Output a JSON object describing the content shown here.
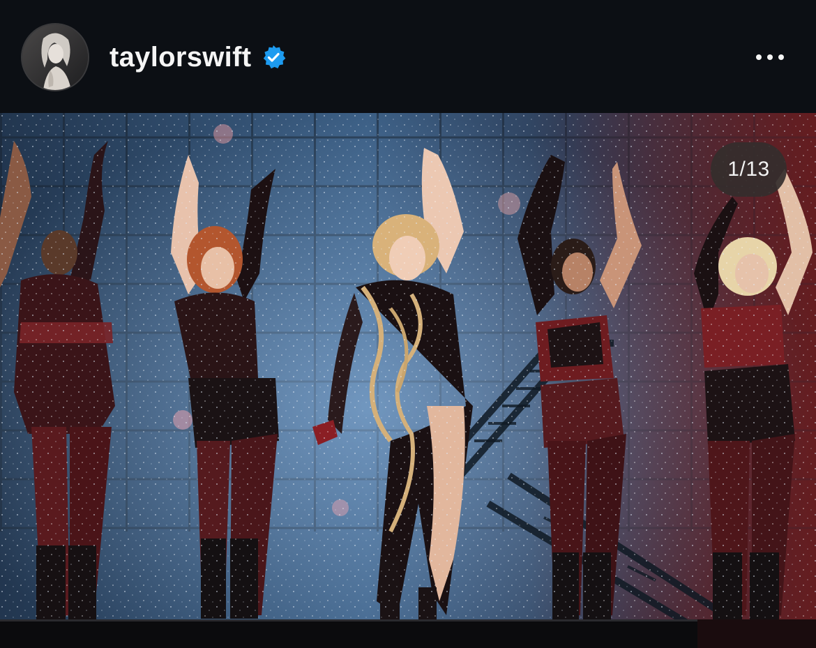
{
  "post": {
    "username": "taylorswift",
    "verified": true,
    "avatar_icon": "profile-photo-avatar",
    "more_icon": "more-options-icon",
    "carousel_counter": "1/13"
  },
  "colors": {
    "background": "#0c0f14",
    "username_text": "#f5f5f5",
    "verified_blue": "#1d9bf0",
    "counter_bg": "#342e2c"
  }
}
